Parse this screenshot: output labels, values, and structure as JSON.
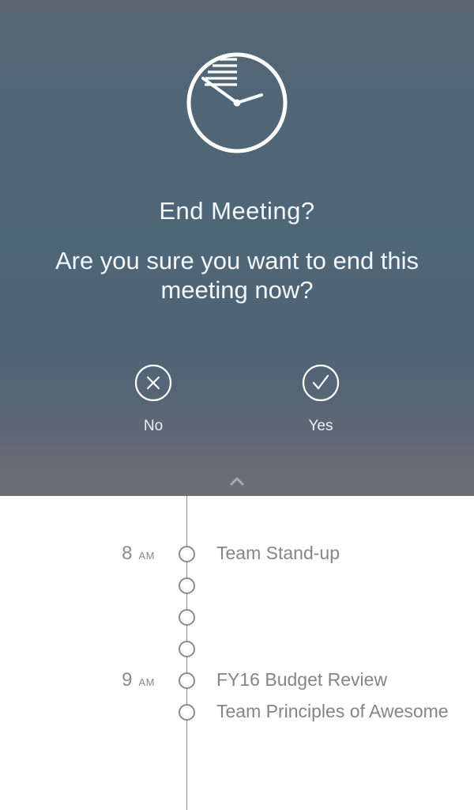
{
  "dialog": {
    "title": "End Meeting?",
    "message": "Are you sure you want to end this meeting now?",
    "icon": "clock-icon",
    "no_label": "No",
    "yes_label": "Yes",
    "no_icon": "close-icon",
    "yes_icon": "check-icon",
    "collapse_icon": "chevron-up-icon"
  },
  "timeline": {
    "slots": [
      {
        "hour": "8",
        "ampm": "AM",
        "event": "Team Stand-up"
      },
      {
        "hour": "",
        "ampm": "",
        "event": ""
      },
      {
        "hour": "",
        "ampm": "",
        "event": ""
      },
      {
        "hour": "",
        "ampm": "",
        "event": ""
      },
      {
        "hour": "9",
        "ampm": "AM",
        "event": "FY16 Budget Review"
      },
      {
        "hour": "",
        "ampm": "",
        "event": "Team Principles of Awesome"
      }
    ]
  },
  "colors": {
    "dialog_bg": "#4f6677",
    "text_light": "#f4f6f8",
    "timeline_gray": "#8a8a8a"
  }
}
